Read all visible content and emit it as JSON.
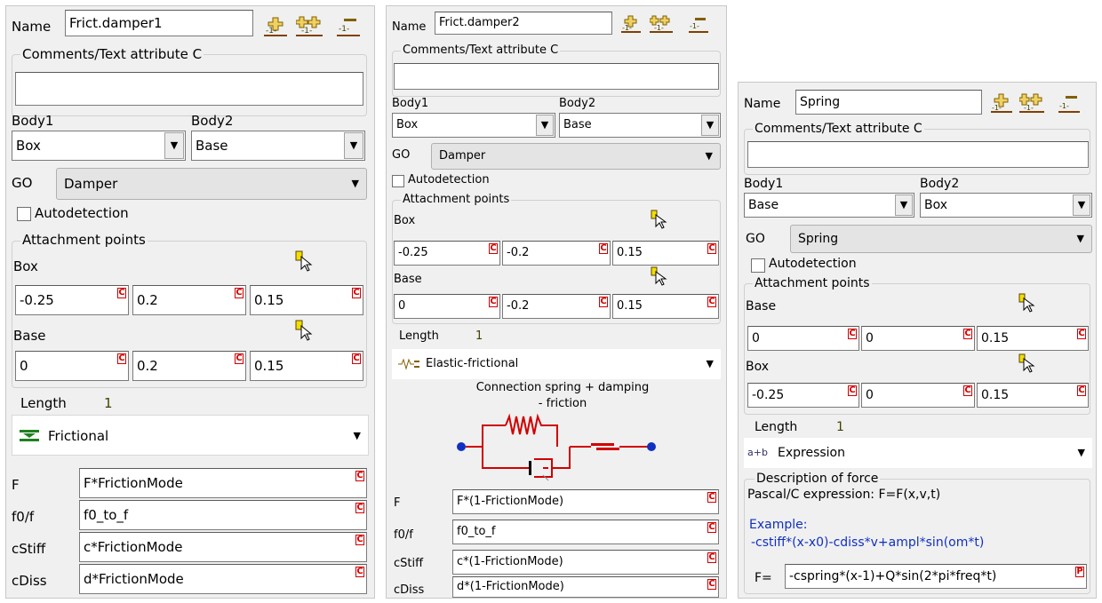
{
  "colors": {
    "accent_blue": "#1030c0",
    "red_mark": "#d00000",
    "length_value": "#404000"
  },
  "p1": {
    "name_label": "Name",
    "name_value": "Frict.damper1",
    "comments_title": "Comments/Text attribute C",
    "comments_value": "",
    "body1_label": "Body1",
    "body2_label": "Body2",
    "body1_value": "Box",
    "body2_value": "Base",
    "go_label": "GO",
    "go_value": "Damper",
    "autodetect_label": "Autodetection",
    "attach_title": "Attachment points",
    "pt1_label": "Box",
    "pt1": [
      "-0.25",
      "0.2",
      "0.15"
    ],
    "pt2_label": "Base",
    "pt2": [
      "0",
      "0.2",
      "0.15"
    ],
    "length_label": "Length",
    "length_value": "1",
    "type_value": "Frictional",
    "type_icon": "frictional-icon",
    "params": [
      {
        "label": "F",
        "value": "F*FrictionMode"
      },
      {
        "label": "f0/f",
        "value": "f0_to_f"
      },
      {
        "label": "cStiff",
        "value": "c*FrictionMode"
      },
      {
        "label": "cDiss",
        "value": "d*FrictionMode"
      }
    ],
    "cmark": "C"
  },
  "p2": {
    "name_label": "Name",
    "name_value": "Frict.damper2",
    "comments_title": "Comments/Text attribute C",
    "comments_value": "",
    "body1_label": "Body1",
    "body2_label": "Body2",
    "body1_value": "Box",
    "body2_value": "Base",
    "go_label": "GO",
    "go_value": "Damper",
    "autodetect_label": "Autodetection",
    "attach_title": "Attachment points",
    "pt1_label": "Box",
    "pt1": [
      "-0.25",
      "-0.2",
      "0.15"
    ],
    "pt2_label": "Base",
    "pt2": [
      "0",
      "-0.2",
      "0.15"
    ],
    "length_label": "Length",
    "length_value": "1",
    "type_value": "Elastic-frictional",
    "type_icon": "elastic-frictional-icon",
    "diagram_caption_1": "Connection spring + damping",
    "diagram_caption_2": "- friction",
    "params": [
      {
        "label": "F",
        "value": "F*(1-FrictionMode)"
      },
      {
        "label": "f0/f",
        "value": "f0_to_f"
      },
      {
        "label": "cStiff",
        "value": "c*(1-FrictionMode)"
      },
      {
        "label": "cDiss",
        "value": "d*(1-FrictionMode)"
      }
    ],
    "cmark": "C"
  },
  "p3": {
    "name_label": "Name",
    "name_value": "Spring",
    "comments_title": "Comments/Text attribute C",
    "comments_value": "",
    "body1_label": "Body1",
    "body2_label": "Body2",
    "body1_value": "Base",
    "body2_value": "Box",
    "go_label": "GO",
    "go_value": "Spring",
    "autodetect_label": "Autodetection",
    "attach_title": "Attachment points",
    "pt1_label": "Base",
    "pt1": [
      "0",
      "0",
      "0.15"
    ],
    "pt2_label": "Box",
    "pt2": [
      "-0.25",
      "0",
      "0.15"
    ],
    "length_label": "Length",
    "length_value": "1",
    "type_value": "Expression",
    "type_icon_text": "a+b",
    "desc_title": "Description of force",
    "desc_line": "Pascal/C expression: F=F(x,v,t)",
    "example_title": "Example:",
    "example_text": "-cstiff*(x-x0)-cdiss*v+ampl*sin(om*t)",
    "f_label": "F=",
    "f_value": "-cspring*(x-1)+Q*sin(2*pi*freq*t)",
    "pmark": "P",
    "cmark": "C"
  }
}
